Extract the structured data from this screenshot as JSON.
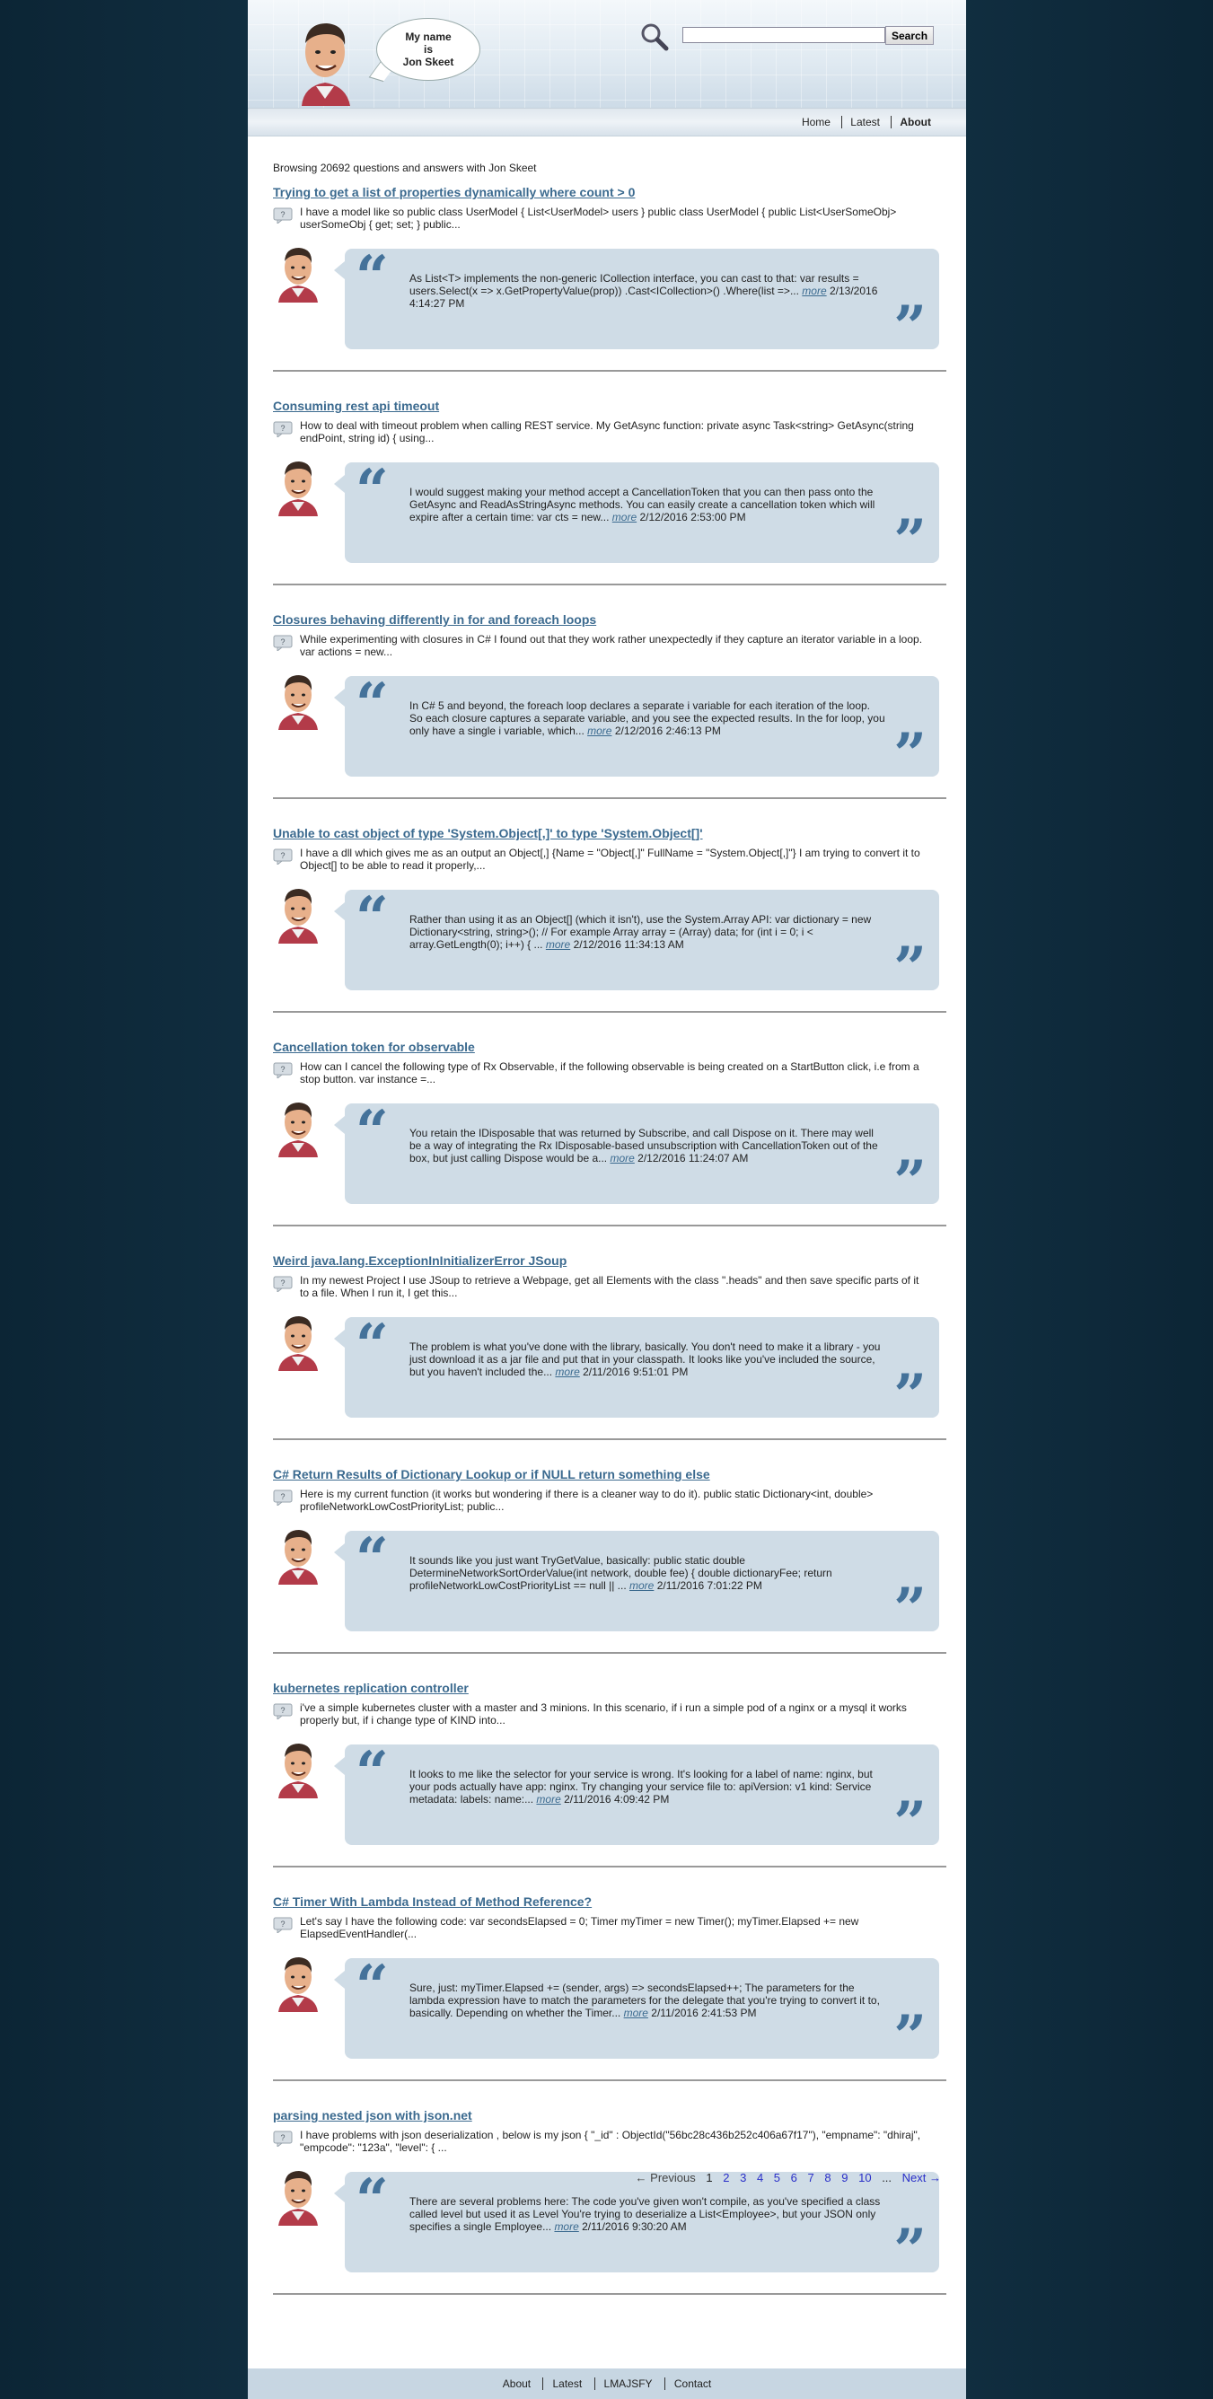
{
  "header": {
    "speech_line1": "My name",
    "speech_line2": "is",
    "speech_line3": "Jon Skeet",
    "search_placeholder": "",
    "search_button": "Search"
  },
  "nav": {
    "items": [
      "Home",
      "Latest",
      "About"
    ],
    "active": "About"
  },
  "browsing": "Browsing 20692 questions and answers with Jon Skeet",
  "more_label": "more",
  "entries": [
    {
      "title": "Trying to get a list of properties dynamically where count > 0",
      "question": "I have a model like so public class UserModel { List<UserModel> users } public class UserModel { public List<UserSomeObj> userSomeObj { get; set; } public...",
      "answer": "As List<T> implements the non-generic ICollection interface, you can cast to that: var results = users.Select(x => x.GetPropertyValue(prop)) .Cast<ICollection>() .Where(list =>...",
      "date": "2/13/2016 4:14:27 PM"
    },
    {
      "title": "Consuming rest api timeout",
      "question": "How to deal with timeout problem when calling REST service. My GetAsync function: private async Task<string> GetAsync(string endPoint, string id) { using...",
      "answer": "I would suggest making your method accept a CancellationToken that you can then pass onto the GetAsync and ReadAsStringAsync methods. You can easily create a cancellation token which will expire after a certain time: var cts = new...",
      "date": "2/12/2016 2:53:00 PM"
    },
    {
      "title": "Closures behaving differently in for and foreach loops",
      "question": "While experimenting with closures in C# I found out that they work rather unexpectedly if they capture an iterator variable in a loop. var actions = new...",
      "answer": "In C# 5 and beyond, the foreach loop declares a separate i variable for each iteration of the loop. So each closure captures a separate variable, and you see the expected results. In the for loop, you only have a single i variable, which...",
      "date": "2/12/2016 2:46:13 PM"
    },
    {
      "title": "Unable to cast object of type 'System.Object[,]' to type 'System.Object[]'",
      "question": "I have a dll which gives me as an output an Object[,] {Name = \"Object[,]\" FullName = \"System.Object[,]\"} I am trying to convert it to Object[] to be able to read it properly,...",
      "answer": "Rather than using it as an Object[] (which it isn't), use the System.Array API: var dictionary = new Dictionary<string, string>(); // For example Array array = (Array) data; for (int i = 0; i < array.GetLength(0); i++) { ...",
      "date": "2/12/2016 11:34:13 AM"
    },
    {
      "title": "Cancellation token for observable",
      "question": "How can I cancel the following type of Rx Observable, if the following observable is being created on a StartButton click, i.e from a stop button. var instance =...",
      "answer": "You retain the IDisposable that was returned by Subscribe, and call Dispose on it. There may well be a way of integrating the Rx IDisposable-based unsubscription with CancellationToken out of the box, but just calling Dispose would be a...",
      "date": "2/12/2016 11:24:07 AM"
    },
    {
      "title": "Weird java.lang.ExceptionInInitializerError JSoup",
      "question": "In my newest Project I use JSoup to retrieve a Webpage, get all Elements with the class \".heads\" and then save specific parts of it to a file. When I run it, I get this...",
      "answer": "The problem is what you've done with the library, basically. You don't need to make it a library - you just download it as a jar file and put that in your classpath. It looks like you've included the source, but you haven't included the...",
      "date": "2/11/2016 9:51:01 PM"
    },
    {
      "title": "C# Return Results of Dictionary Lookup or if NULL return something else",
      "question": "Here is my current function (it works but wondering if there is a cleaner way to do it). public static Dictionary<int, double> profileNetworkLowCostPriorityList; public...",
      "answer": "It sounds like you just want TryGetValue, basically: public static double DetermineNetworkSortOrderValue(int network, double fee) { double dictionaryFee; return profileNetworkLowCostPriorityList == null || ...",
      "date": "2/11/2016 7:01:22 PM"
    },
    {
      "title": "kubernetes replication controller",
      "question": "i've a simple kubernetes cluster with a master and 3 minions. In this scenario, if i run a simple pod of a nginx or a mysql it works properly but, if i change type of KIND into...",
      "answer": "It looks to me like the selector for your service is wrong. It's looking for a label of name: nginx, but your pods actually have app: nginx. Try changing your service file to: apiVersion: v1 kind: Service metadata: labels: name:...",
      "date": "2/11/2016 4:09:42 PM"
    },
    {
      "title": "C# Timer With Lambda Instead of Method Reference?",
      "question": "Let's say I have the following code: var secondsElapsed = 0; Timer myTimer = new Timer(); myTimer.Elapsed += new ElapsedEventHandler(...",
      "answer": "Sure, just: myTimer.Elapsed += (sender, args) => secondsElapsed++; The parameters for the lambda expression have to match the parameters for the delegate that you're trying to convert it to, basically. Depending on whether the Timer...",
      "date": "2/11/2016 2:41:53 PM"
    },
    {
      "title": "parsing nested json with json.net",
      "question": "I have problems with json deserialization , below is my json { \"_id\" : ObjectId(\"56bc28c436b252c406a67f17\"), \"empname\": \"dhiraj\", \"empcode\": \"123a\", \"level\": { ...",
      "answer": "There are several problems here: The code you've given won't compile, as you've specified a class called level but used it as Level You're trying to deserialize a List<Employee>, but your JSON only specifies a single Employee...",
      "date": "2/11/2016 9:30:20 AM"
    }
  ],
  "pager": {
    "previous": "← Previous",
    "current": "1",
    "pages": [
      "2",
      "3",
      "4",
      "5",
      "6",
      "7",
      "8",
      "9",
      "10"
    ],
    "ellipsis": "...",
    "next": "Next →"
  },
  "footer": {
    "items": [
      "About",
      "Latest",
      "LMAJSFY",
      "Contact"
    ]
  },
  "colors": {
    "link": "#3b6a8f",
    "quote_box": "#cfdce6",
    "background": "#15384c"
  }
}
